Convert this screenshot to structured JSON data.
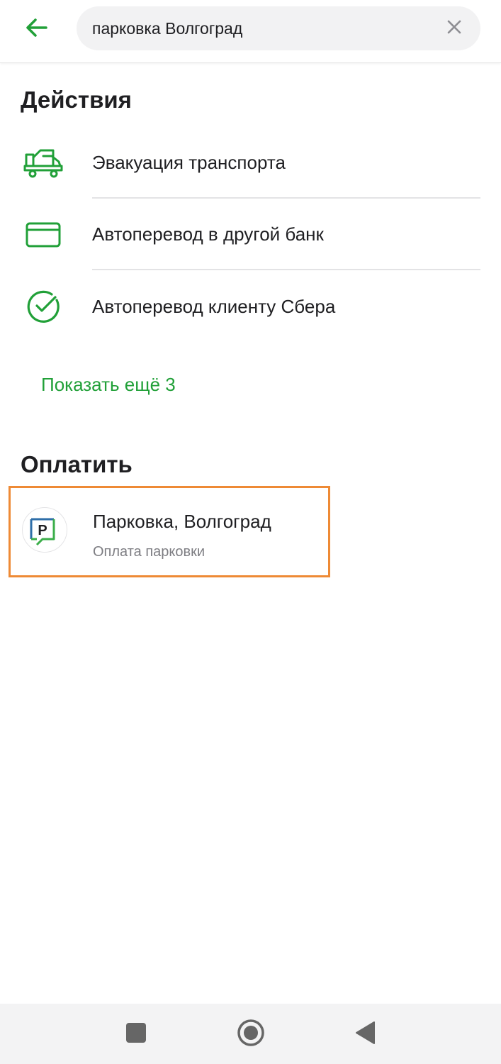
{
  "search": {
    "value": "парковка Волгоград"
  },
  "icons": {
    "back": "arrow-left-icon",
    "clear": "close-icon"
  },
  "colors": {
    "accent": "#21a038",
    "highlight": "#ee8a35",
    "text_primary": "#1f1f22",
    "text_secondary": "#7d7d82"
  },
  "actions": {
    "title": "Действия",
    "items": [
      {
        "label": "Эвакуация транспорта",
        "icon": "tow-truck-icon"
      },
      {
        "label": "Автоперевод в другой банк",
        "icon": "card-icon"
      },
      {
        "label": "Автоперевод клиенту Сбера",
        "icon": "sber-check-icon"
      }
    ],
    "show_more": "Показать ещё 3"
  },
  "pay": {
    "title": "Оплатить",
    "items": [
      {
        "title": "Парковка, Волгоград",
        "subtitle": "Оплата парковки",
        "icon": "parking-icon",
        "icon_letter": "P"
      }
    ]
  },
  "navbar": {
    "buttons": [
      "recent-apps-icon",
      "home-icon",
      "back-triangle-icon"
    ]
  }
}
